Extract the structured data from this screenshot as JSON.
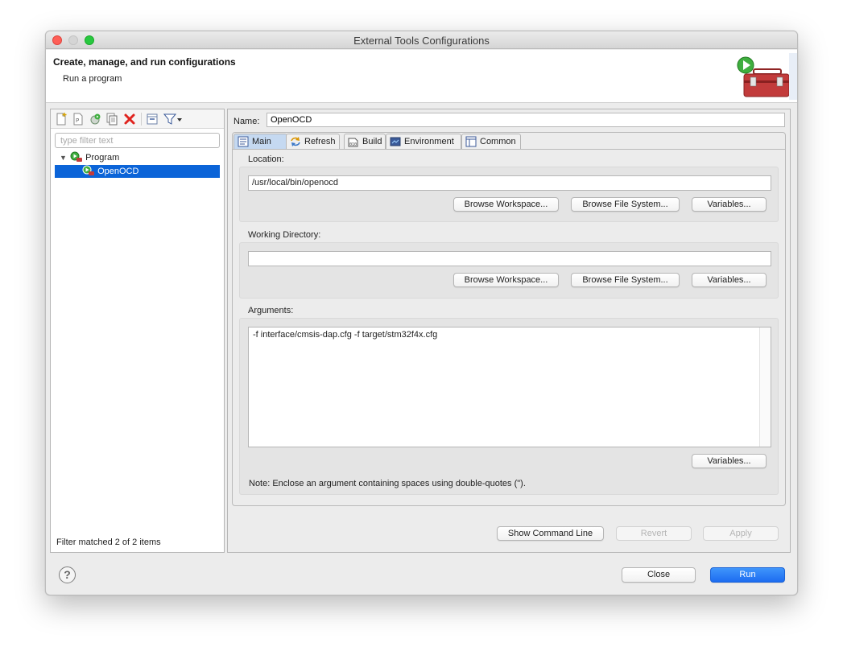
{
  "window": {
    "title": "External Tools Configurations"
  },
  "header": {
    "title": "Create, manage, and run configurations",
    "subtitle": "Run a program"
  },
  "left": {
    "filter_placeholder": "type filter text",
    "tree": [
      {
        "label": "Program",
        "type": "category",
        "expanded": true
      },
      {
        "label": "OpenOCD",
        "type": "configuration",
        "selected": true
      }
    ],
    "status": "Filter matched 2 of 2 items",
    "toolbar": [
      "new-configuration-icon",
      "new-prototype-icon",
      "export-icon",
      "duplicate-icon",
      "delete-icon",
      "collapse-all-icon",
      "filter-icon"
    ]
  },
  "config": {
    "name_label": "Name:",
    "name": "OpenOCD",
    "tabs": [
      "Main",
      "Refresh",
      "Build",
      "Environment",
      "Common"
    ],
    "active_tab": "Main",
    "location": {
      "label": "Location:",
      "value": "/usr/local/bin/openocd"
    },
    "working_dir": {
      "label": "Working Directory:",
      "value": ""
    },
    "arguments": {
      "label": "Arguments:",
      "value": "-f interface/cmsis-dap.cfg -f target/stm32f4x.cfg",
      "note": "Note: Enclose an argument containing spaces using double-quotes (\")."
    },
    "buttons": {
      "browse_workspace": "Browse Workspace...",
      "browse_fs": "Browse File System...",
      "variables": "Variables..."
    },
    "actions": {
      "show_cmd": "Show Command Line",
      "revert": "Revert",
      "apply": "Apply"
    }
  },
  "footer": {
    "help": "?",
    "close": "Close",
    "run": "Run"
  },
  "colors": {
    "selection": "#0b64d8",
    "primary_button": "#1d6cf0",
    "active_tab": "#c5d9f1"
  }
}
